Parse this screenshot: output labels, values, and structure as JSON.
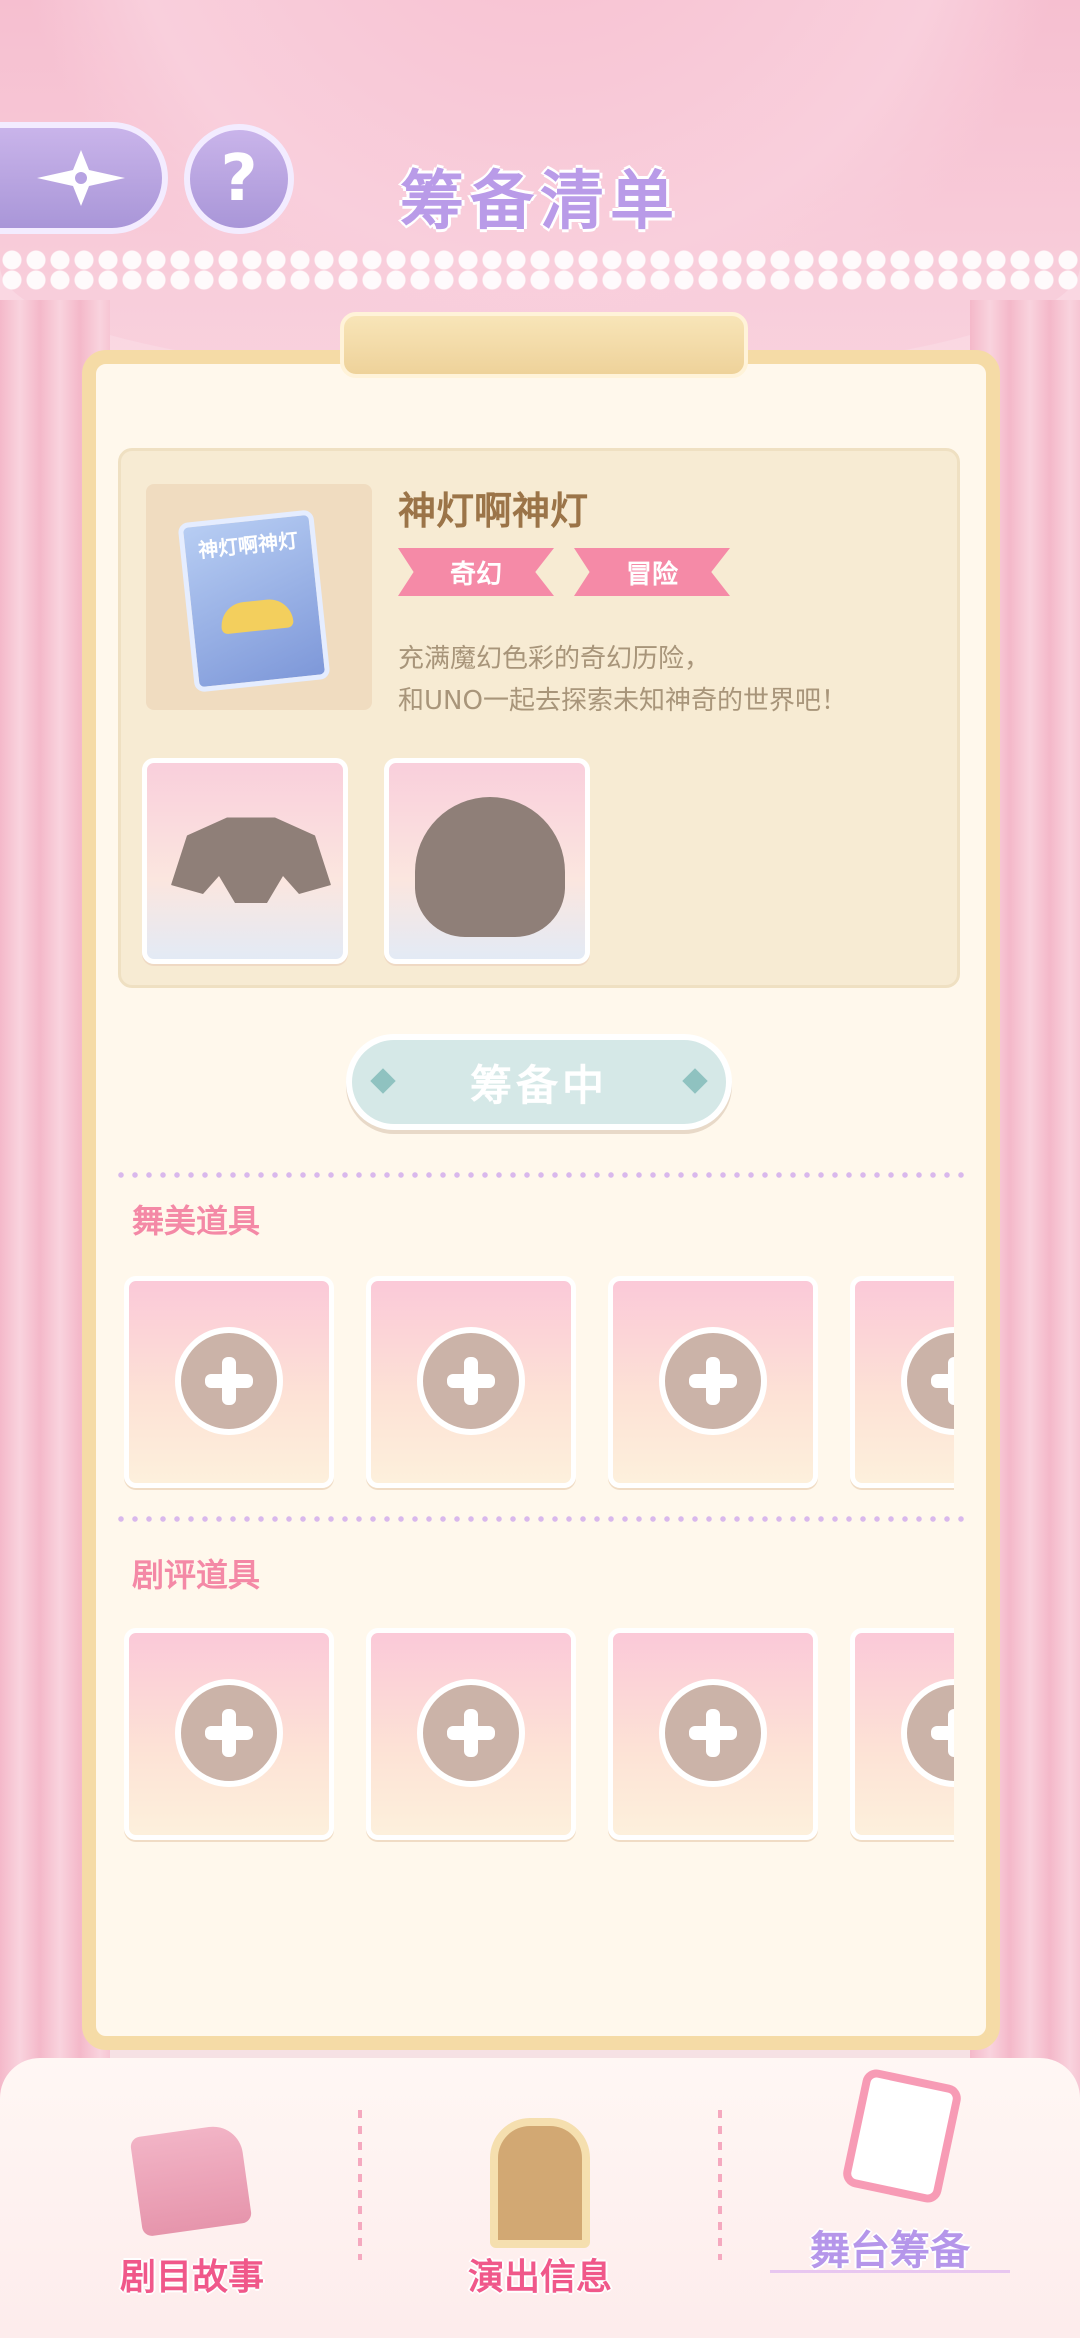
{
  "header": {
    "title": "筹备清单",
    "help_label": "?"
  },
  "story": {
    "title": "神灯啊神灯",
    "book_cover_title": "神灯啊神灯",
    "tags": [
      "奇幻",
      "冒险"
    ],
    "description_line1": "充满魔幻色彩的奇幻历险，",
    "description_line2": "和UNO一起去探索未知神奇的世界吧！"
  },
  "status": {
    "label": "筹备中"
  },
  "sections": {
    "stage_props": "舞美道具",
    "review_props": "剧评道具"
  },
  "bottom_nav": {
    "items": [
      {
        "label": "剧目故事"
      },
      {
        "label": "演出信息"
      },
      {
        "label": "舞台筹备"
      }
    ]
  },
  "colors": {
    "accent_purple": "#b99be8",
    "tag_pink": "#f58aa7",
    "panel_border": "#f5dba6"
  }
}
